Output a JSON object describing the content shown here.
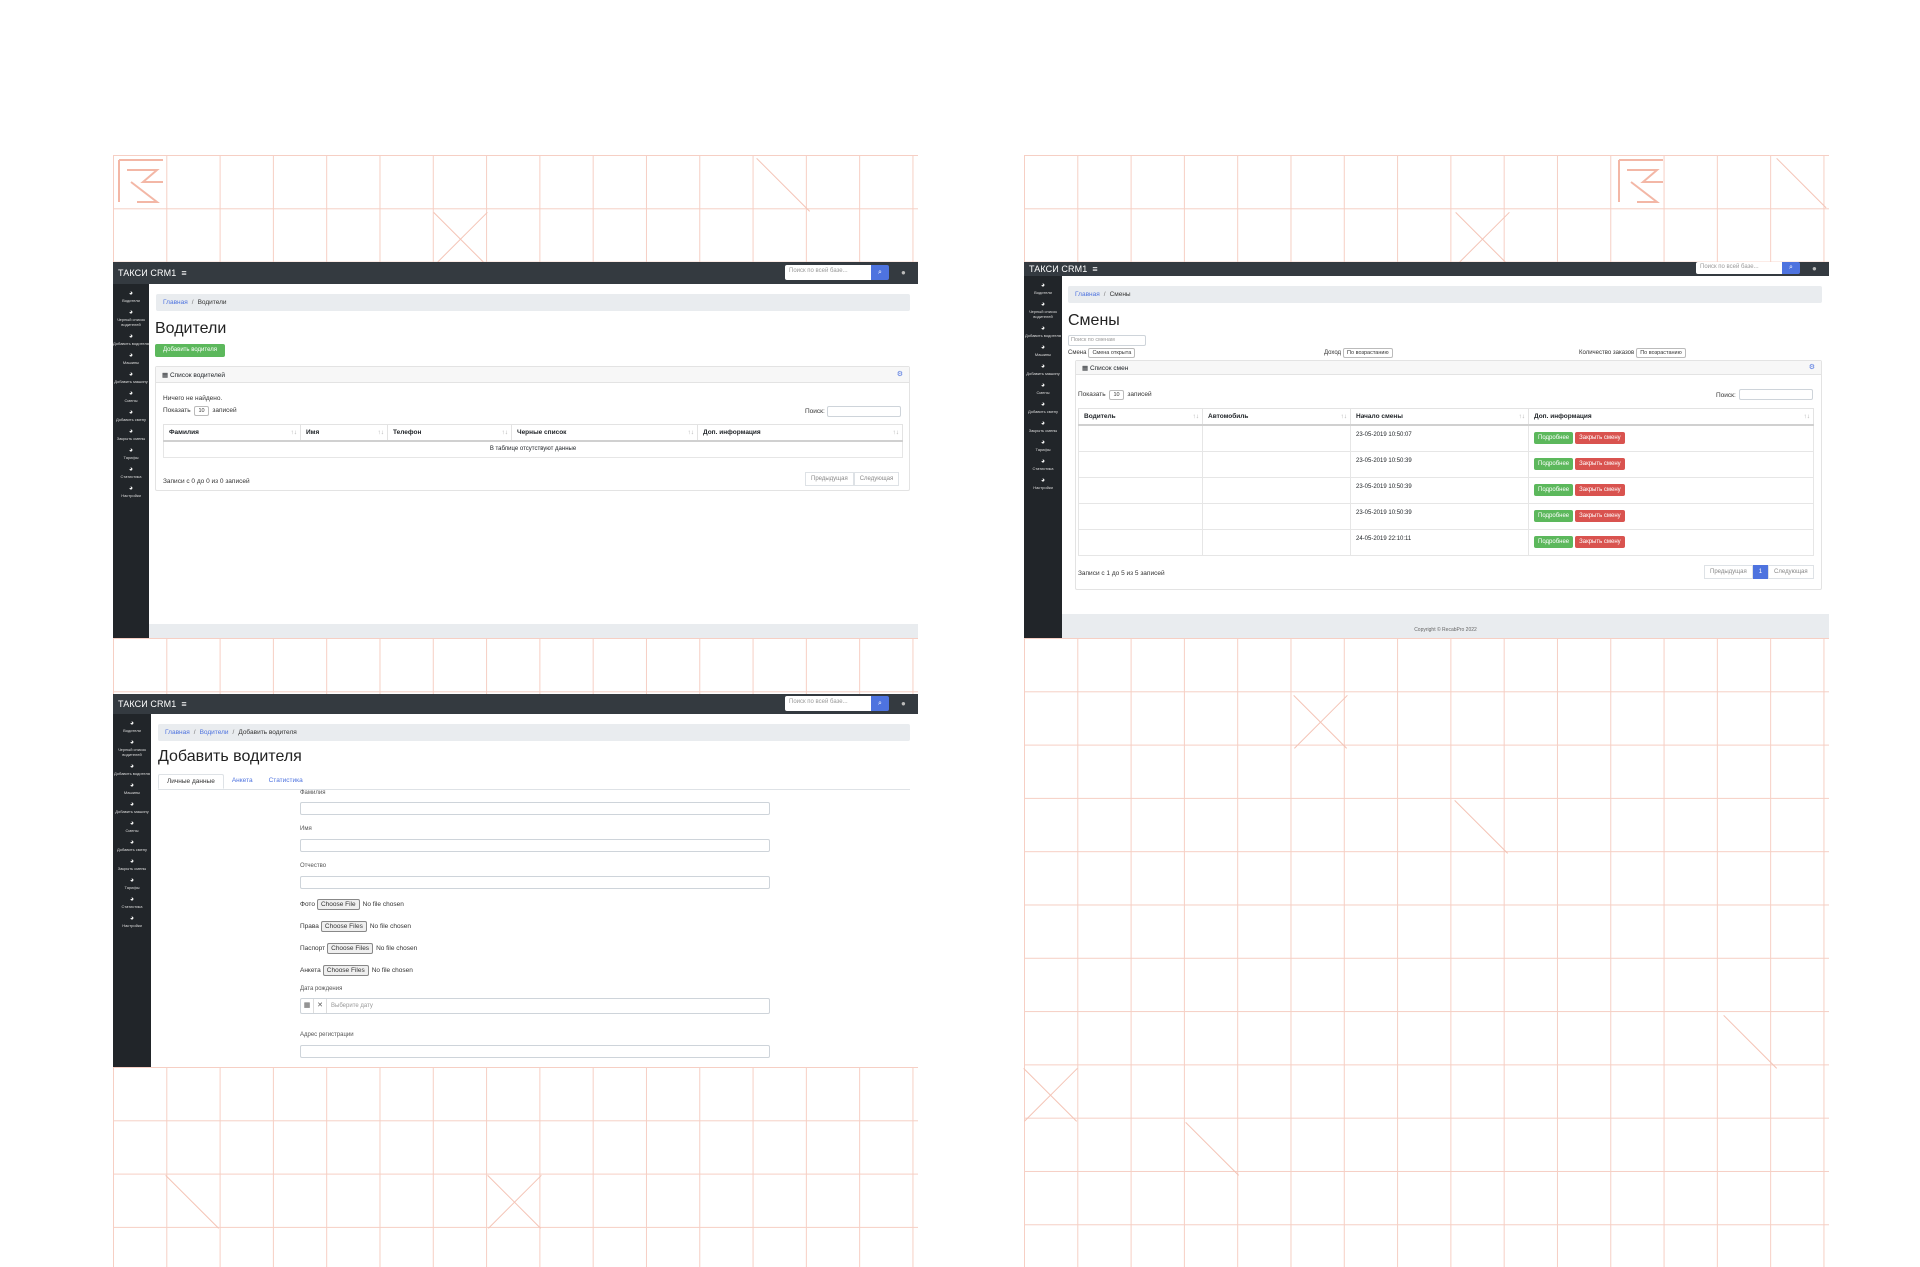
{
  "app": {
    "brand": "ТАКСИ CRM1",
    "search_placeholder": "Поиск по всей базе..."
  },
  "sidebar": {
    "items": [
      {
        "label": "Водители",
        "icon": "dashboard-icon"
      },
      {
        "label": "Черный список водителей",
        "icon": "dashboard-icon"
      },
      {
        "label": "Добавить водителя",
        "icon": "dashboard-icon"
      },
      {
        "label": "Машины",
        "icon": "dashboard-icon"
      },
      {
        "label": "Добавить машину",
        "icon": "dashboard-icon"
      },
      {
        "label": "Смены",
        "icon": "dashboard-icon"
      },
      {
        "label": "Добавить смену",
        "icon": "dashboard-icon"
      },
      {
        "label": "Закрыть смены",
        "icon": "dashboard-icon"
      },
      {
        "label": "Тарифы",
        "icon": "dashboard-icon"
      },
      {
        "label": "Статистика",
        "icon": "dashboard-icon"
      },
      {
        "label": "Настройки",
        "icon": "dashboard-icon"
      }
    ]
  },
  "drivers": {
    "breadcrumb": [
      "Главная",
      "Водители"
    ],
    "title": "Водители",
    "add_button": "Добавить водителя",
    "card_title": "Список водителей",
    "not_found": "Ничего не найдено.",
    "show_label": "Показать",
    "show_value": "10",
    "records_label": "записей",
    "search_label": "Поиск:",
    "columns": [
      "Фамилия",
      "Имя",
      "Телефон",
      "Черные список",
      "Доп. информация"
    ],
    "empty": "В таблице отсутствуют данные",
    "info": "Записи с 0 до 0 из 0 записей",
    "prev": "Предыдущая",
    "next": "Следующая"
  },
  "shifts": {
    "breadcrumb": [
      "Главная",
      "Смены"
    ],
    "title": "Смены",
    "search_placeholder": "Поиск по сменам",
    "filter_shift_label": "Смена",
    "filter_shift_value": "Смена открыта",
    "filter_income_label": "Доход",
    "filter_income_value": "По возрастанию",
    "filter_orders_label": "Количество заказов",
    "filter_orders_value": "По возрастанию",
    "card_title": "Список смен",
    "show_label": "Показать",
    "show_value": "10",
    "records_label": "записей",
    "search_label": "Поиск:",
    "columns": [
      "Водитель",
      "Автомобиль",
      "Начало смены",
      "Доп. информация"
    ],
    "rows": [
      {
        "driver": "",
        "car": "",
        "start": "23-05-2019 10:50:07"
      },
      {
        "driver": "",
        "car": "",
        "start": "23-05-2019 10:50:39"
      },
      {
        "driver": "",
        "car": "",
        "start": "23-05-2019 10:50:39"
      },
      {
        "driver": "",
        "car": "",
        "start": "23-05-2019 10:50:39"
      },
      {
        "driver": "",
        "car": "",
        "start": "24-05-2019 22:10:11"
      }
    ],
    "details_button": "Подробнее",
    "close_button": "Закрыть смену",
    "info": "Записи с 1 до 5 из 5 записей",
    "prev": "Предыдущая",
    "page": "1",
    "next": "Следующая",
    "footer": "Copyright © RecabPro 2022"
  },
  "add_driver": {
    "breadcrumb": [
      "Главная",
      "Водители",
      "Добавить водителя"
    ],
    "title": "Добавить водителя",
    "tabs": [
      "Личные данные",
      "Анкета",
      "Статистика"
    ],
    "fields": {
      "last_name": "Фамилия",
      "first_name": "Имя",
      "patronymic": "Отчество",
      "photo": "Фото",
      "license": "Права",
      "passport": "Паспорт",
      "form": "Анкета",
      "birth_date": "Дата рождения",
      "birth_placeholder": "Выберите дату",
      "address": "Адрес регистрации"
    },
    "choose_file": "Choose File",
    "choose_files": "Choose Files",
    "no_file": "No file chosen"
  }
}
